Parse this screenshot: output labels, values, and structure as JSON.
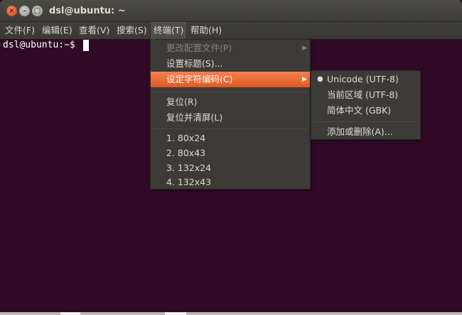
{
  "window": {
    "title": "dsl@ubuntu: ~",
    "controls": {
      "close": "×",
      "minimize": "–",
      "maximize": "□"
    }
  },
  "menubar": {
    "items": [
      {
        "label": "文件(F)"
      },
      {
        "label": "编辑(E)"
      },
      {
        "label": "查看(V)"
      },
      {
        "label": "搜索(S)"
      },
      {
        "label": "终端(T)",
        "active": true
      },
      {
        "label": "帮助(H)"
      }
    ]
  },
  "terminal": {
    "prompt": "dsl@ubuntu:~$ "
  },
  "terminal_menu": {
    "items": [
      {
        "label": "更改配置文件(P)",
        "disabled": true,
        "submenu_arrow": "▶"
      },
      {
        "label": "设置标题(S)..."
      },
      {
        "label": "设定字符编码(C)",
        "highlighted": true,
        "submenu_arrow": "▶"
      },
      {
        "label": "复位(R)"
      },
      {
        "label": "复位并清屏(L)"
      },
      {
        "label": "1. 80x24"
      },
      {
        "label": "2. 80x43"
      },
      {
        "label": "3. 132x24"
      },
      {
        "label": "4. 132x43"
      }
    ]
  },
  "encoding_menu": {
    "items": [
      {
        "label": "Unicode (UTF-8)",
        "selected": true,
        "bullet": "●"
      },
      {
        "label": "当前区域 (UTF-8)"
      },
      {
        "label": "简体中文 (GBK)"
      },
      {
        "label": "添加或删除(A)..."
      }
    ]
  }
}
